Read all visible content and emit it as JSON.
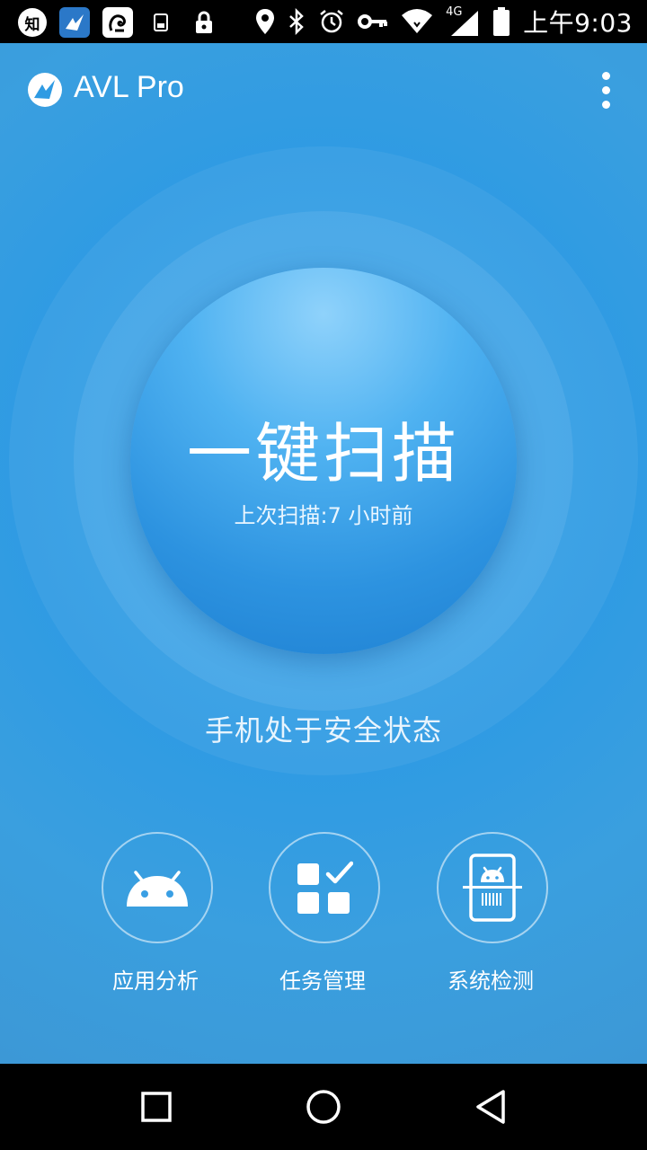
{
  "status_bar": {
    "notification_badge": "知",
    "time": "上午9:03",
    "network_type": "4G"
  },
  "app": {
    "title": "AVL Pro"
  },
  "scan": {
    "title": "一键扫描",
    "subtitle": "上次扫描:7 小时前"
  },
  "phone_status": "手机处于安全状态",
  "features": [
    {
      "label": "应用分析",
      "icon": "android-icon"
    },
    {
      "label": "任务管理",
      "icon": "task-grid-icon"
    },
    {
      "label": "系统检测",
      "icon": "phone-scan-icon"
    }
  ],
  "colors": {
    "background": "#2f9be3",
    "scan_button": "#2d93e0"
  }
}
